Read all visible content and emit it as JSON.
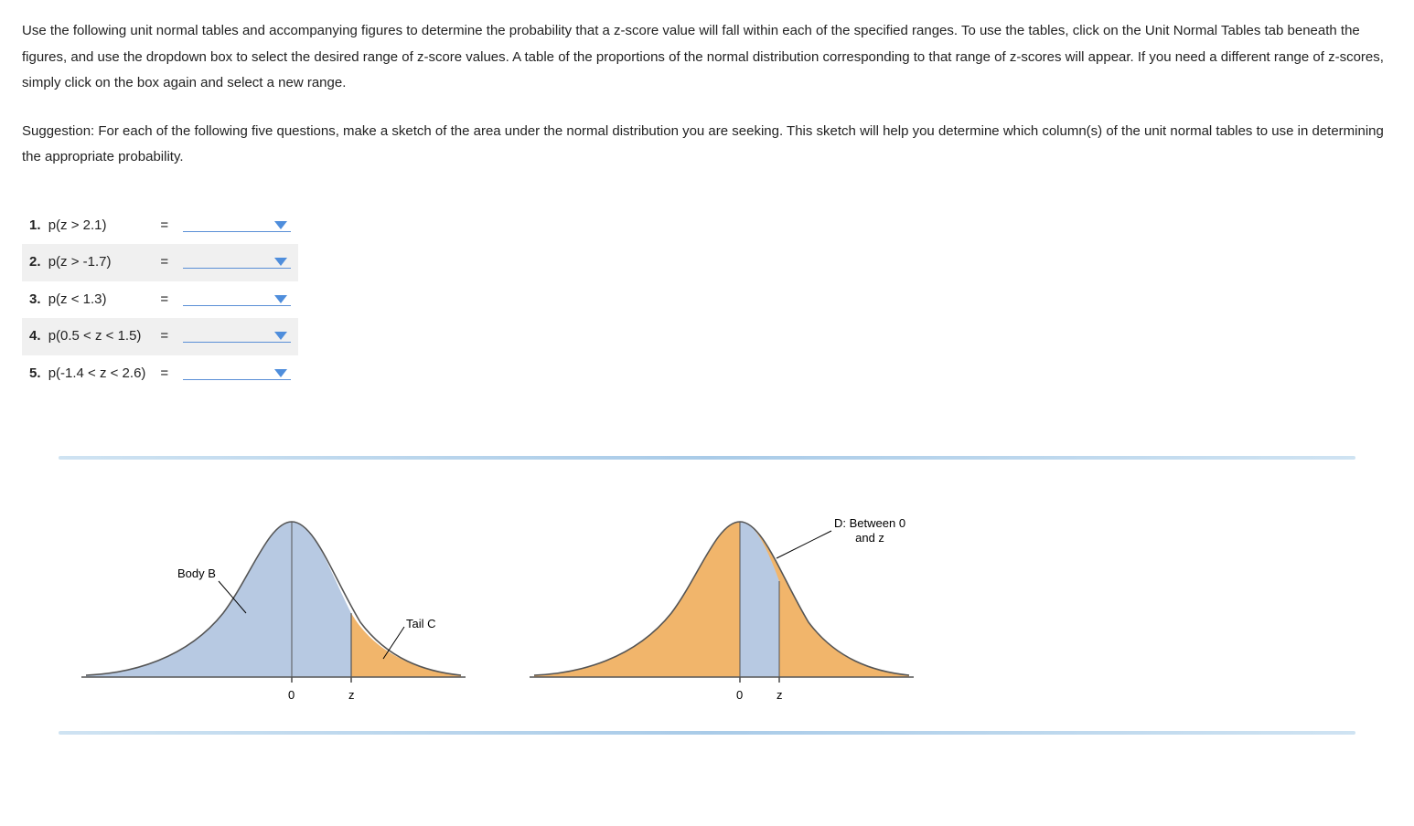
{
  "intro": {
    "para1": "Use the following unit normal tables and accompanying figures to determine the probability that a z-score value will fall within each of the specified ranges. To use the tables, click on the Unit Normal Tables tab beneath the figures, and use the dropdown box to select the desired range of z-score values. A table of the proportions of the normal distribution corresponding to that range of z-scores will appear. If you need a different range of z-scores, simply click on the box again and select a new range.",
    "para2": "Suggestion: For each of the following five questions, make a sketch of the area under the normal distribution you are seeking. This sketch will help you determine which column(s) of the unit normal tables to use in determining the appropriate probability."
  },
  "questions": [
    {
      "num": "1.",
      "expr": "p(z > 2.1)",
      "eq": "="
    },
    {
      "num": "2.",
      "expr": "p(z > -1.7)",
      "eq": "="
    },
    {
      "num": "3.",
      "expr": "p(z < 1.3)",
      "eq": "="
    },
    {
      "num": "4.",
      "expr": "p(0.5 < z < 1.5)",
      "eq": "="
    },
    {
      "num": "5.",
      "expr": "p(-1.4 < z < 2.6)",
      "eq": "="
    }
  ],
  "figure1": {
    "body_label": "Body B",
    "tail_label": "Tail C",
    "axis_zero": "0",
    "axis_z": "z"
  },
  "figure2": {
    "between_label_line1": "D: Between 0",
    "between_label_line2": "and z",
    "axis_zero": "0",
    "axis_z": "z"
  },
  "chart_data": [
    {
      "type": "area",
      "title": "Normal distribution: Body B and Tail C",
      "xlabel": "",
      "ylabel": "",
      "annotations": [
        "Body B",
        "Tail C"
      ],
      "axis_ticks": [
        "0",
        "z"
      ],
      "regions": [
        {
          "name": "Body B",
          "range": "(-inf, z]",
          "color": "#b7c9e2"
        },
        {
          "name": "Tail C",
          "range": "[z, +inf)",
          "color": "#f1b56b"
        }
      ],
      "z_marker": "positive"
    },
    {
      "type": "area",
      "title": "Normal distribution: D between 0 and z",
      "xlabel": "",
      "ylabel": "",
      "annotations": [
        "D: Between 0 and z"
      ],
      "axis_ticks": [
        "0",
        "z"
      ],
      "regions": [
        {
          "name": "Full curve",
          "range": "(-inf, +inf)",
          "color": "#f1b56b"
        },
        {
          "name": "D: Between 0 and z",
          "range": "[0, z]",
          "color": "#b7c9e2"
        }
      ],
      "z_marker": "positive"
    }
  ]
}
